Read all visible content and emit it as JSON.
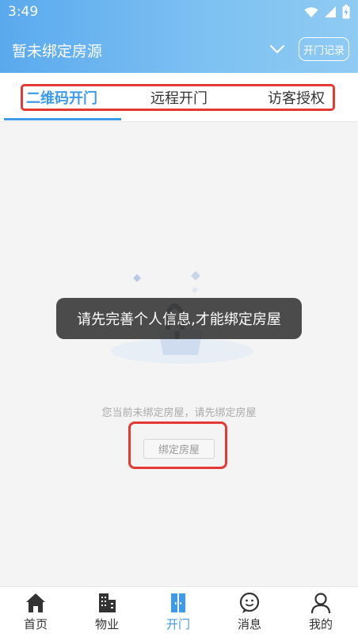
{
  "status_bar": {
    "time": "3:49",
    "icons": [
      "wifi-icon",
      "signal-icon",
      "battery-charging-icon"
    ]
  },
  "header": {
    "title": "暂未绑定房源",
    "dropdown_icon": "chevron-down-icon",
    "record_button": "开门记录"
  },
  "tabs": {
    "items": [
      {
        "label": "二维码开门",
        "active": true
      },
      {
        "label": "远程开门",
        "active": false
      },
      {
        "label": "访客授权",
        "active": false
      }
    ]
  },
  "content": {
    "illustration_icon": "lock-illustration-icon",
    "toast": "请先完善个人信息,才能绑定房屋",
    "empty_message": "您当前未绑定房屋，请先绑定房屋",
    "bind_button": "绑定房屋"
  },
  "bottom_nav": {
    "items": [
      {
        "label": "首页",
        "icon": "home-icon",
        "active": false
      },
      {
        "label": "物业",
        "icon": "building-icon",
        "active": false
      },
      {
        "label": "开门",
        "icon": "door-icon",
        "active": true
      },
      {
        "label": "消息",
        "icon": "message-icon",
        "active": false
      },
      {
        "label": "我的",
        "icon": "user-icon",
        "active": false
      }
    ]
  },
  "colors": {
    "accent": "#3d9be9",
    "header_gradient_start": "#5aa9ee",
    "header_gradient_end": "#8fcbf3",
    "highlight_outline": "#e53935",
    "nav_inactive": "#333333"
  }
}
